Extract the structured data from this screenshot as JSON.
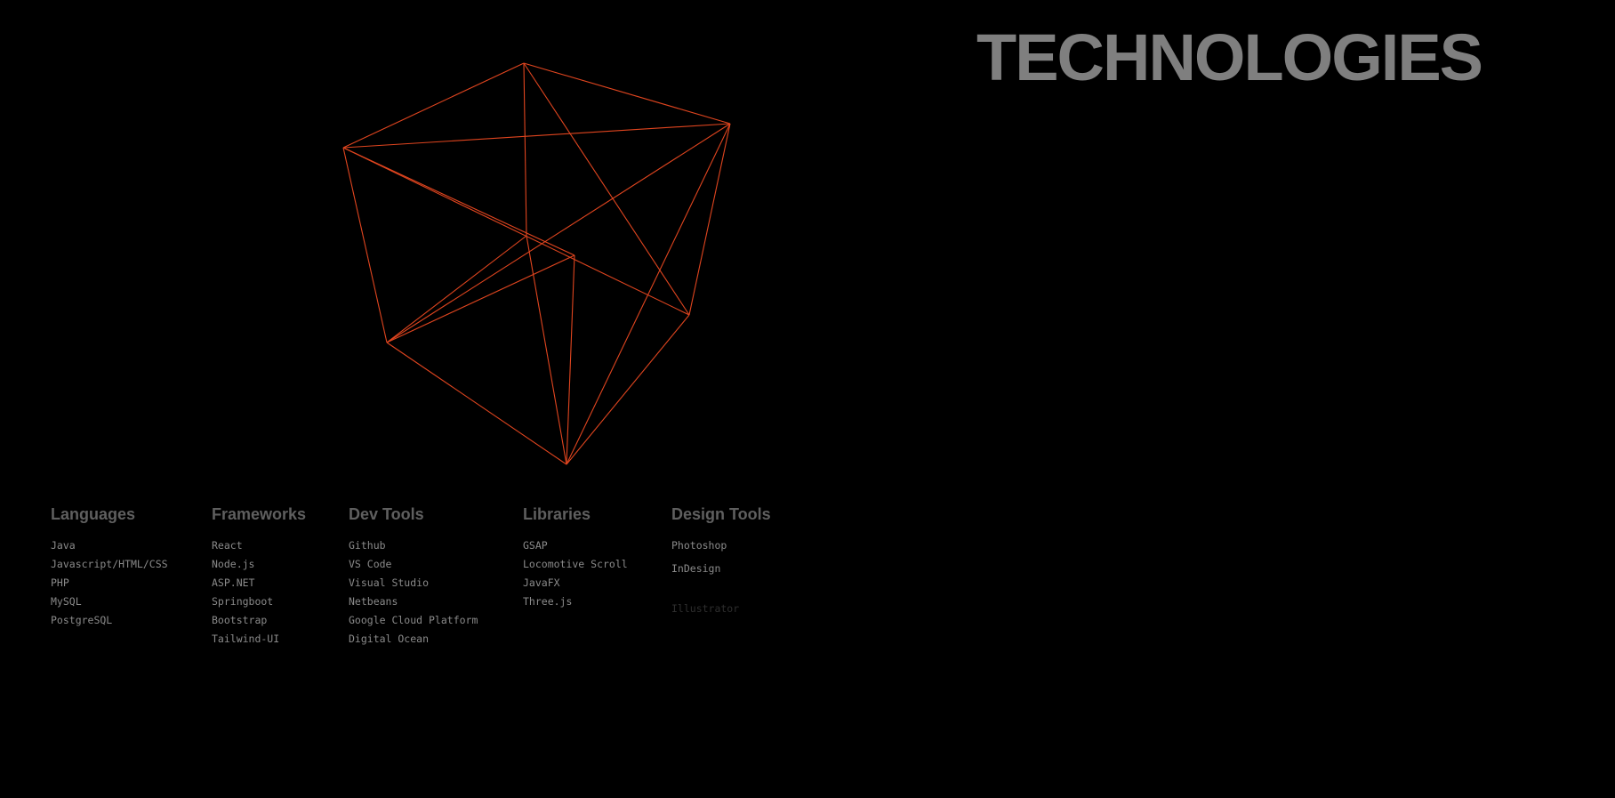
{
  "page": {
    "title": "TECHNOLOGIES",
    "accent_color": "#e0451f",
    "background_color": "#000000"
  },
  "columns": [
    {
      "heading": "Languages",
      "items": [
        "Java",
        "Javascript/HTML/CSS",
        "PHP",
        "MySQL",
        "PostgreSQL"
      ]
    },
    {
      "heading": "Frameworks",
      "items": [
        "React",
        "Node.js",
        "ASP.NET",
        "Springboot",
        "Bootstrap",
        "Tailwind-UI"
      ]
    },
    {
      "heading": "Dev Tools",
      "items": [
        "Github",
        "VS Code",
        "Visual Studio",
        "Netbeans",
        "Google Cloud Platform",
        "Digital Ocean"
      ]
    },
    {
      "heading": "Libraries",
      "items": [
        "GSAP",
        "Locomotive Scroll",
        "JavaFX",
        "Three.js"
      ]
    },
    {
      "heading": "Design Tools",
      "items": [
        "Photoshop",
        "InDesign",
        "Illustrator"
      ]
    }
  ]
}
